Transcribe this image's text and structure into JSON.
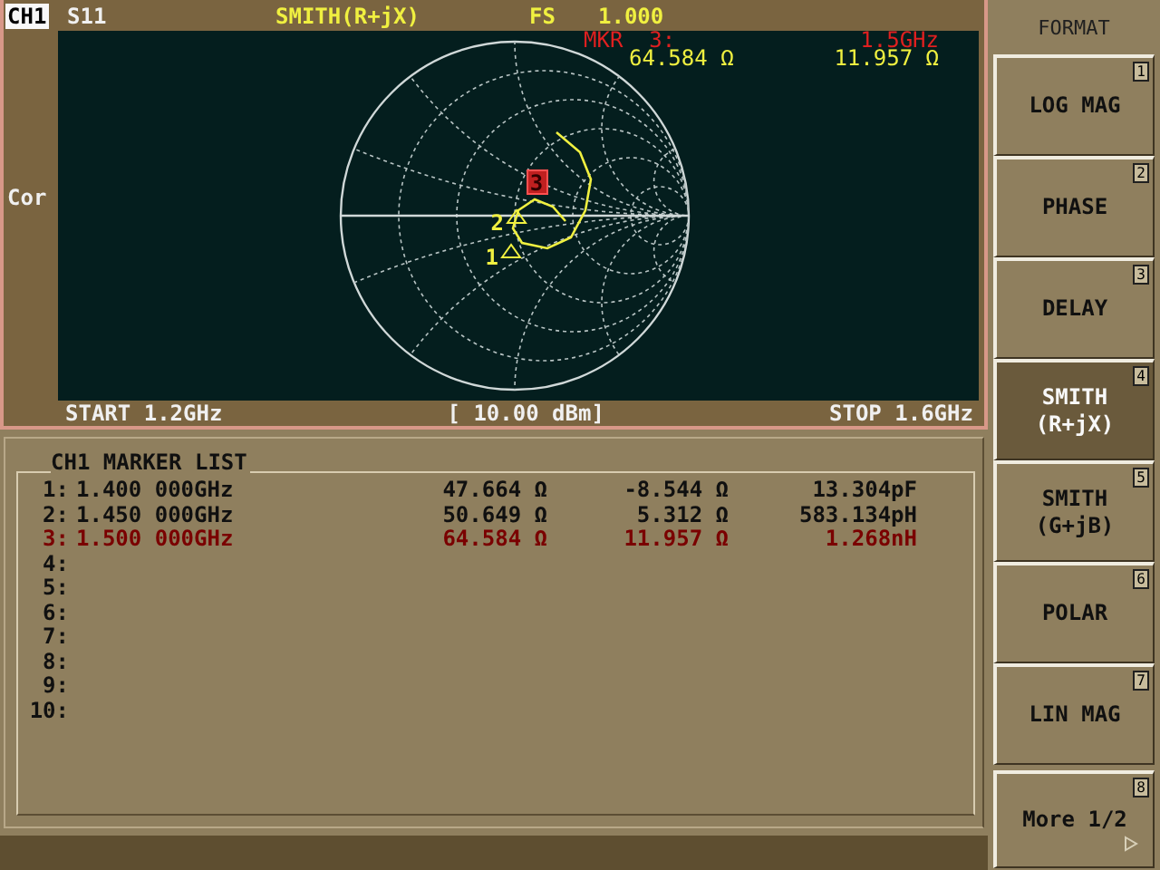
{
  "header": {
    "channel": "CH1",
    "parameter": "S11",
    "format": "SMITH(R+jX)",
    "scale_label": "FS",
    "scale_value": "1.000"
  },
  "side_label": "Cor",
  "marker_readout": {
    "label": "MKR  3:",
    "frequency": "1.5GHz",
    "resistance": "64.584 Ω",
    "reactance": "11.957 Ω"
  },
  "chart_markers": [
    {
      "label": "1",
      "selected": false
    },
    {
      "label": "2",
      "selected": false
    },
    {
      "label": "3",
      "selected": true
    }
  ],
  "footer": {
    "start": "START 1.2GHz",
    "power": "[ 10.00 dBm]",
    "stop": "STOP 1.6GHz"
  },
  "marker_list": {
    "title": "CH1 MARKER LIST",
    "rows": [
      {
        "index": "1:",
        "frequency": "1.400 000GHz",
        "resistance": "47.664 Ω",
        "reactance": "-8.544 Ω",
        "value": "13.304pF",
        "selected": false
      },
      {
        "index": "2:",
        "frequency": "1.450 000GHz",
        "resistance": "50.649 Ω",
        "reactance": "5.312 Ω",
        "value": "583.134pH",
        "selected": false
      },
      {
        "index": "3:",
        "frequency": "1.500 000GHz",
        "resistance": "64.584 Ω",
        "reactance": "11.957 Ω",
        "value": "1.268nH",
        "selected": true
      },
      {
        "index": "4:",
        "selected": false
      },
      {
        "index": "5:",
        "selected": false
      },
      {
        "index": "6:",
        "selected": false
      },
      {
        "index": "7:",
        "selected": false
      },
      {
        "index": "8:",
        "selected": false
      },
      {
        "index": "9:",
        "selected": false
      },
      {
        "index": "10:",
        "selected": false
      }
    ]
  },
  "softkeys": {
    "title": "FORMAT",
    "keys": [
      {
        "lines": [
          "LOG MAG"
        ],
        "number": "1",
        "selected": false
      },
      {
        "lines": [
          "PHASE"
        ],
        "number": "2",
        "selected": false
      },
      {
        "lines": [
          "DELAY"
        ],
        "number": "3",
        "selected": false
      },
      {
        "lines": [
          "SMITH",
          "(R+jX)"
        ],
        "number": "4",
        "selected": true
      },
      {
        "lines": [
          "SMITH",
          "(G+jB)"
        ],
        "number": "5",
        "selected": false
      },
      {
        "lines": [
          "POLAR"
        ],
        "number": "6",
        "selected": false
      },
      {
        "lines": [
          "LIN MAG"
        ],
        "number": "7",
        "selected": false
      },
      {
        "lines": [
          "More 1/2"
        ],
        "number": "8",
        "selected": false,
        "submenu": true
      }
    ]
  }
}
